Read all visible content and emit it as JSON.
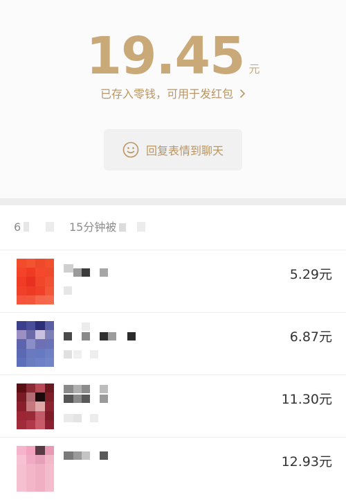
{
  "header": {
    "title": "·",
    "amount": "19.45",
    "amount_unit": "元",
    "stored_link": "已存入零钱，可用于发红包",
    "reply_button": "回复表情到聊天"
  },
  "summary": {
    "count_text": "6",
    "time_text": "15分钟被"
  },
  "records": [
    {
      "amount": "5.29元"
    },
    {
      "amount": "6.87元"
    },
    {
      "amount": "11.30元"
    },
    {
      "amount": "12.93元"
    }
  ],
  "colors": {
    "gold": "#c9a978",
    "gold_text": "#b99562"
  },
  "icons": {
    "reply": "smile-icon",
    "link": "chevron-right-icon"
  }
}
